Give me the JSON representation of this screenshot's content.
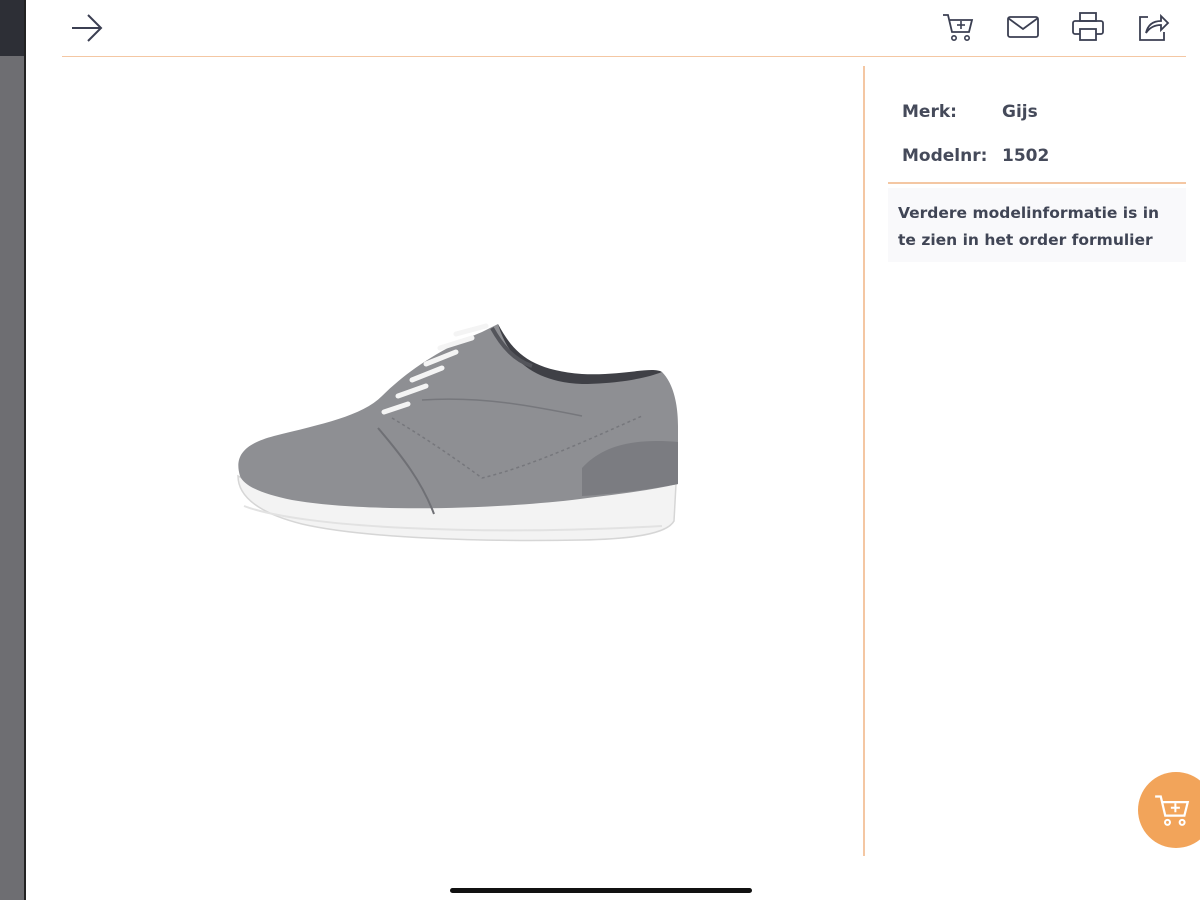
{
  "header": {
    "back_icon": "arrow-right-icon",
    "actions": [
      {
        "name": "add-to-cart",
        "icon": "cart-plus-icon"
      },
      {
        "name": "email",
        "icon": "mail-icon"
      },
      {
        "name": "print",
        "icon": "printer-icon"
      },
      {
        "name": "share",
        "icon": "share-icon"
      }
    ]
  },
  "product": {
    "image_alt_icon": "shoe-image",
    "specs": [
      {
        "label": "Merk:",
        "value": "Gijs"
      },
      {
        "label": "Modelnr:",
        "value": "1502"
      }
    ],
    "note": "Verdere modelinformatie is in te zien in het order formulier"
  },
  "fab": {
    "icon": "cart-plus-icon"
  },
  "colors": {
    "accent": "#f2a45a",
    "divider": "#f4c7a3",
    "text": "#454a5a"
  }
}
